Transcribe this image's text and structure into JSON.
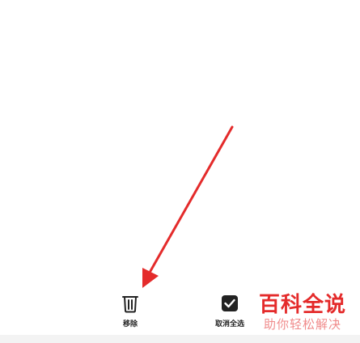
{
  "toolbar": {
    "remove_label": "移除",
    "deselect_all_label": "取消全选"
  },
  "icons": {
    "remove": "trash-icon",
    "deselect_all": "checked-box-icon",
    "annotation": "red-arrow-icon"
  },
  "watermark": {
    "logo_text": "百科全说",
    "slogan_text": "助你轻松解决"
  },
  "colors": {
    "annotation_arrow": "#e42b2b",
    "watermark": "#e42b2b",
    "icon": "#222222",
    "background": "#ffffff"
  }
}
